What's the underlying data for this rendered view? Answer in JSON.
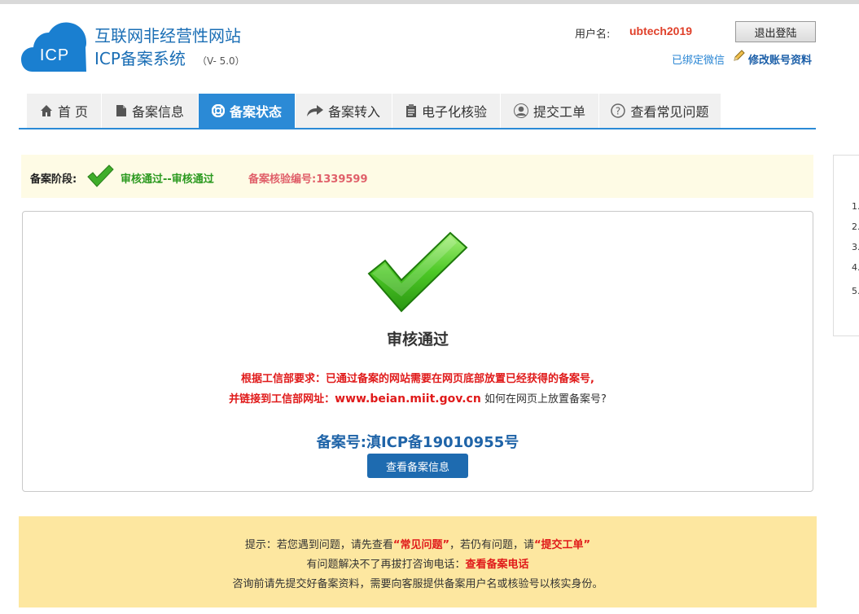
{
  "header": {
    "title": "互联网非经营性网站",
    "subtitle": "ICP备案系统",
    "version": "（V- 5.0）",
    "logo_text": "ICP"
  },
  "user": {
    "label": "用户名:",
    "name": "ubtech2019",
    "logout": "退出登陆",
    "wechat_bound": "已绑定微信",
    "edit_account": "修改账号资料"
  },
  "nav": {
    "tabs": [
      {
        "label": "首 页",
        "icon": "home-icon"
      },
      {
        "label": "备案信息",
        "icon": "document-icon"
      },
      {
        "label": "备案状态",
        "icon": "lifebuoy-icon",
        "active": true
      },
      {
        "label": "备案转入",
        "icon": "share-arrow-icon"
      },
      {
        "label": "电子化核验",
        "icon": "clipboard-icon"
      },
      {
        "label": "提交工单",
        "icon": "user-icon"
      },
      {
        "label": "查看常见问题",
        "icon": "question-icon"
      }
    ]
  },
  "stage": {
    "label": "备案阶段:",
    "status": "审核通过--审核通过",
    "code": "备案核验编号:1339599"
  },
  "result": {
    "title": "审核通过",
    "requirement_line1": "根据工信部要求：已通过备案的网站需要在网页底部放置已经获得的备案号,",
    "requirement_line2_prefix": "并链接到工信部网址：",
    "url": "www.beian.miit.gov.cn",
    "how_link": "如何在网页上放置备案号?",
    "record_number": "备案号:滇ICP备19010955号",
    "view_button": "查看备案信息"
  },
  "tips": {
    "line1_a": "提示：若您遇到问题，请先查看",
    "line1_faq": "“常见问题”",
    "line1_b": "，若仍有问题，请",
    "line1_ticket": "“提交工单”",
    "line2_a": "有问题解决不了再拔打咨询电话：",
    "line2_link": "查看备案电话",
    "line3": "咨询前请先提交好备案资料，需要向客服提供备案用户名或核验号以核实身份。"
  },
  "side_panel": {
    "items": [
      "1.",
      "2.",
      "3.",
      "4.",
      "5."
    ]
  },
  "colors": {
    "brand_blue": "#1a6eb5",
    "nav_active": "#2b8ad6",
    "success_green": "#2c9a20",
    "alert_red": "#e01a1a",
    "tips_bg": "#fde7a0"
  }
}
